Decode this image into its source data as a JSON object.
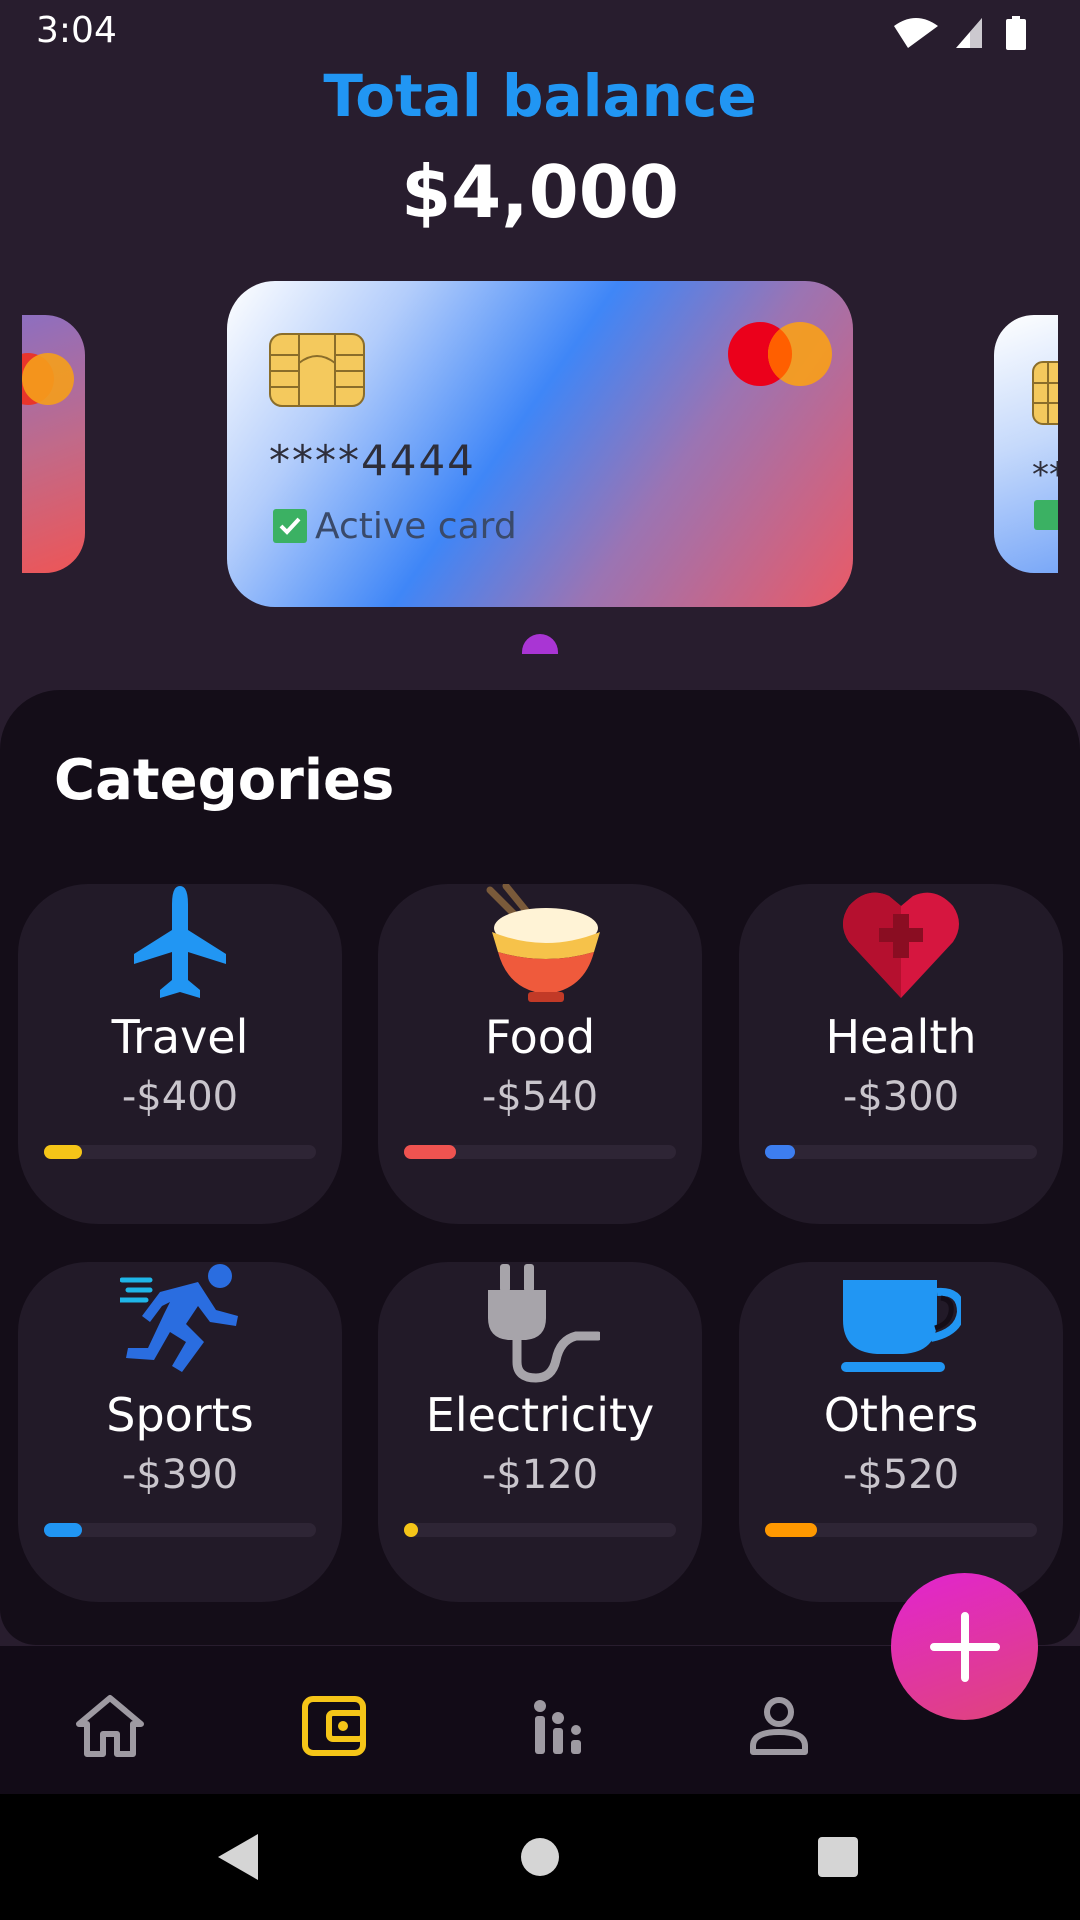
{
  "status_bar": {
    "time": "3:04",
    "icons": [
      "wifi-icon",
      "signal-icon",
      "battery-icon"
    ]
  },
  "header": {
    "title": "Total balance",
    "amount": "$4,000"
  },
  "cards": {
    "active_index": 1,
    "main": {
      "number": "****4444",
      "status_label": "Active card",
      "status_checked": true,
      "brand": "mastercard"
    },
    "right_peek_number": "**"
  },
  "categories": {
    "title": "Categories",
    "items": [
      {
        "name": "Travel",
        "amount": "-$400",
        "icon": "airplane-icon",
        "color": "#f5c518",
        "progress": 0.14
      },
      {
        "name": "Food",
        "amount": "-$540",
        "icon": "rice-bowl-icon",
        "color": "#ef5350",
        "progress": 0.19
      },
      {
        "name": "Health",
        "amount": "-$300",
        "icon": "heart-cross-icon",
        "color": "#3d7ef0",
        "progress": 0.11
      },
      {
        "name": "Sports",
        "amount": "-$390",
        "icon": "runner-icon",
        "color": "#2196f3",
        "progress": 0.14
      },
      {
        "name": "Electricity",
        "amount": "-$120",
        "icon": "plug-icon",
        "color": "#f5c518",
        "progress": 0.04
      },
      {
        "name": "Others",
        "amount": "-$520",
        "icon": "coffee-cup-icon",
        "color": "#ff9800",
        "progress": 0.19
      }
    ]
  },
  "fab": {
    "icon": "plus-icon"
  },
  "bottom_nav": {
    "items": [
      {
        "icon": "home-icon",
        "active": false
      },
      {
        "icon": "wallet-icon",
        "active": true
      },
      {
        "icon": "stats-icon",
        "active": false
      },
      {
        "icon": "profile-icon",
        "active": false
      }
    ],
    "active_color": "#f5c518",
    "inactive_color": "#9e9aa2"
  },
  "system_nav": [
    "back-icon",
    "home-circle-icon",
    "recents-icon"
  ]
}
